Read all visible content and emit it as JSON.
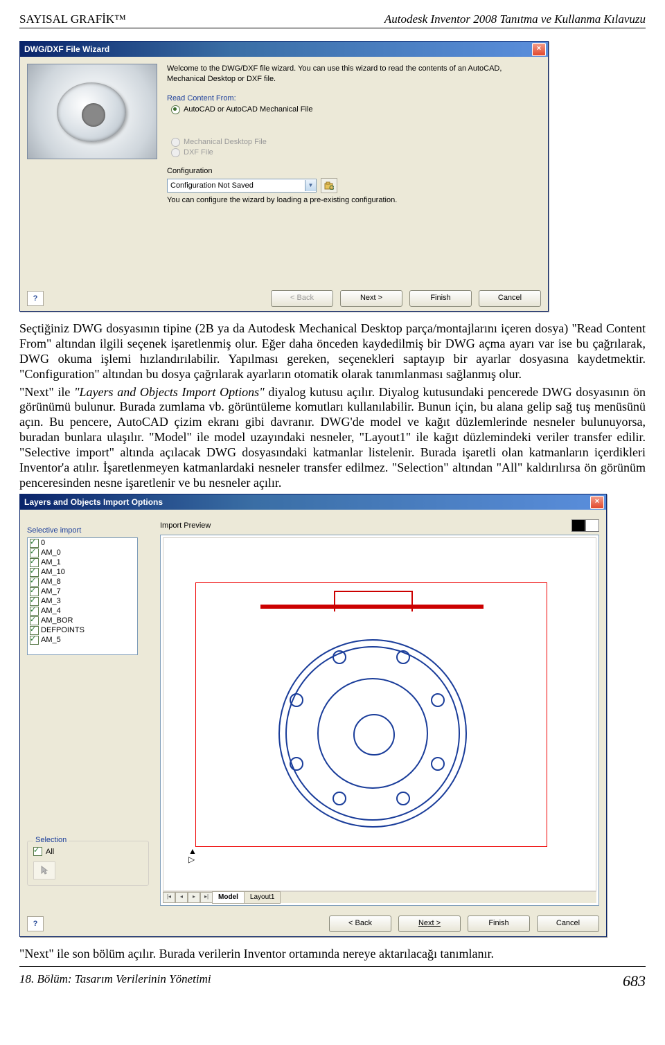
{
  "header": {
    "left": "SAYISAL GRAFİK™",
    "right": "Autodesk Inventor 2008 Tanıtma ve Kullanma Kılavuzu"
  },
  "dialog1": {
    "title": "DWG/DXF File Wizard",
    "intro": "Welcome to the DWG/DXF file wizard. You can use this wizard to read the contents of an AutoCAD, Mechanical Desktop or DXF file.",
    "readContentLabel": "Read Content From:",
    "optAutoCAD": "AutoCAD or AutoCAD Mechanical File",
    "optMDT": "Mechanical Desktop File",
    "optDXF": "DXF File",
    "configLabel": "Configuration",
    "configValue": "Configuration Not Saved",
    "configHint": "You can configure the wizard by loading a pre-existing configuration.",
    "buttons": {
      "back": "< Back",
      "next": "Next >",
      "finish": "Finish",
      "cancel": "Cancel",
      "help": "?"
    }
  },
  "para1": "Seçtiğiniz DWG dosyasının tipine (2B ya da Autodesk Mechanical Desktop parça/montajlarını içeren dosya) \"Read Content From\" altından ilgili seçenek işaretlenmiş olur. Eğer daha önceden kaydedilmiş bir DWG açma ayarı var ise bu çağrılarak, DWG okuma işlemi hızlandırılabilir. Yapılması gereken, seçenekleri saptayıp bir ayarlar dosyasına kaydetmektir. \"Configuration\" altından bu dosya çağrılarak ayarların otomatik olarak tanımlanması sağlanmış olur.",
  "para2a": "\"Next\" ile ",
  "para2b": "\"Layers and Objects Import Options\"",
  "para2c": " diyalog kutusu açılır. Diyalog kutusundaki pencerede DWG dosyasının ön görünümü bulunur. Burada zumlama vb. görüntüleme komutları kullanılabilir. Bunun için, bu alana gelip sağ tuş menüsünü açın. Bu pencere, AutoCAD çizim ekranı gibi davranır. DWG'de model ve kağıt düzlemlerinde nesneler bulunuyorsa, buradan bunlara ulaşılır. \"Model\" ile model uzayındaki nesneler, \"Layout1\" ile kağıt düzlemindeki veriler transfer edilir. \"Selective import\" altında açılacak DWG dosyasındaki katmanlar listelenir. Burada işaretli olan katmanların içerdikleri Inventor'a atılır. İşaretlenmeyen katmanlardaki nesneler transfer edilmez. \"Selection\" altından \"All\" kaldırılırsa ön görünüm penceresinden nesne işaretlenir ve bu nesneler açılır.",
  "dialog2": {
    "title": "Layers and Objects Import Options",
    "selectiveImport": "Selective import",
    "layers": [
      "0",
      "AM_0",
      "AM_1",
      "AM_10",
      "AM_8",
      "AM_7",
      "AM_3",
      "AM_4",
      "AM_BOR",
      "DEFPOINTS",
      "AM_5"
    ],
    "selectionLabel": "Selection",
    "selectionAll": "All",
    "previewLabel": "Import Preview",
    "tabs": {
      "model": "Model",
      "layout1": "Layout1"
    },
    "buttons": {
      "back": "< Back",
      "next": "Next >",
      "finish": "Finish",
      "cancel": "Cancel",
      "help": "?"
    }
  },
  "para3": "\"Next\" ile son bölüm açılır. Burada verilerin Inventor ortamında nereye aktarılacağı tanımlanır.",
  "footer": {
    "left": "18. Bölüm: Tasarım Verilerinin Yönetimi",
    "right": "683"
  }
}
